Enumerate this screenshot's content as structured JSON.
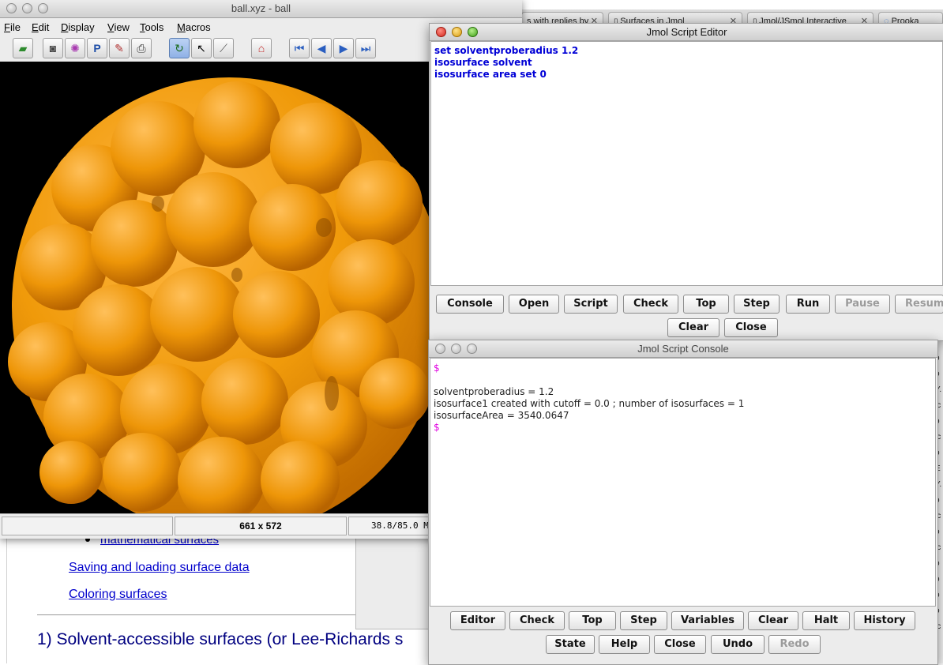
{
  "browser": {
    "tabs": [
      {
        "label": "s with replies by"
      },
      {
        "label": "Surfaces in Jmol"
      },
      {
        "label": "Jmol/JSmol Interactive"
      },
      {
        "label": "Prooka"
      }
    ],
    "page": {
      "bullet_link": "mathematical surfaces",
      "link_saving": "Saving and loading surface data",
      "link_coloring": "Coloring surfaces",
      "heading": "1) Solvent-accessible surfaces (or Lee-Richards s"
    },
    "right_strip": [
      "o",
      "o",
      "Y.",
      "ic",
      "o",
      "ic",
      "o",
      "E",
      "Y.",
      "o",
      "ic",
      "o",
      "ic",
      "o",
      "o",
      "o",
      "o",
      "ic"
    ]
  },
  "main_window": {
    "title": "ball.xyz - ball",
    "menu": [
      {
        "underline": "F",
        "rest": "ile"
      },
      {
        "underline": "E",
        "rest": "dit"
      },
      {
        "underline": "D",
        "rest": "isplay"
      },
      {
        "underline": "V",
        "rest": "iew"
      },
      {
        "underline": "T",
        "rest": "ools"
      },
      {
        "underline": "M",
        "rest": "acros"
      }
    ],
    "status": {
      "cell1": "",
      "size": "661 x 572",
      "coords": "38.8/85.0 M"
    },
    "surface_color": "#f09a0a"
  },
  "editor": {
    "title": "Jmol Script Editor",
    "lines": [
      "set solventproberadius 1.2",
      "isosurface solvent",
      "isosurface area set 0"
    ],
    "buttons": {
      "console": "Console",
      "open": "Open",
      "script": "Script",
      "check": "Check",
      "top": "Top",
      "step": "Step",
      "run": "Run",
      "pause": "Pause",
      "resume": "Resume",
      "clear": "Clear",
      "close": "Close"
    }
  },
  "console": {
    "title": "Jmol Script Console",
    "prompt": "$",
    "lines": [
      "",
      "solventproberadius = 1.2",
      "isosurface1 created with cutoff = 0.0 ; number of isosurfaces = 1",
      "isosurfaceArea = 3540.0647"
    ],
    "buttons": {
      "editor": "Editor",
      "check": "Check",
      "top": "Top",
      "step": "Step",
      "variables": "Variables",
      "clear": "Clear",
      "halt": "Halt",
      "history": "History",
      "state": "State",
      "help": "Help",
      "close": "Close",
      "undo": "Undo",
      "redo": "Redo"
    }
  }
}
